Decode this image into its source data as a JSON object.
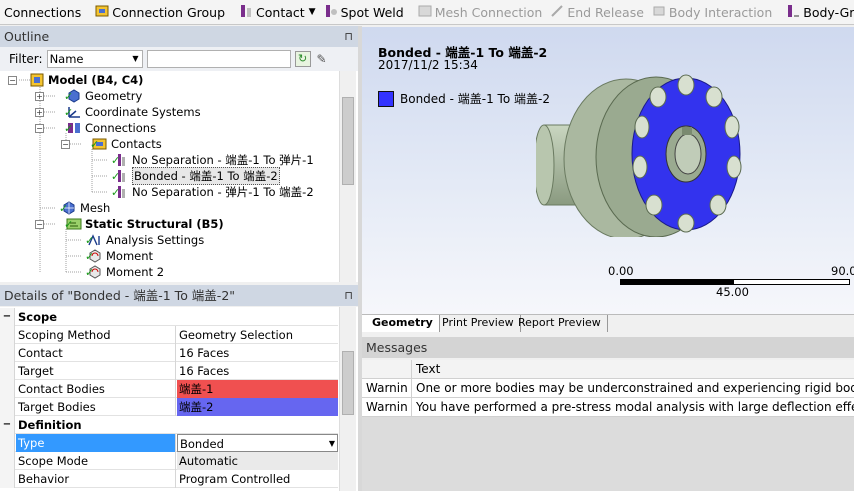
{
  "toolbar": {
    "connections": "Connections",
    "connection_group": "Connection Group",
    "contact": "Contact",
    "spot_weld": "Spot Weld",
    "mesh_connection": "Mesh Connection",
    "end_release": "End Release",
    "body_interaction": "Body Interaction",
    "body_ground": "Body-Grou"
  },
  "outline": {
    "title": "Outline",
    "filter_label": "Filter:",
    "filter_value": "Name",
    "tree": [
      {
        "label": "Model (B4, C4)",
        "bold": true
      },
      {
        "label": "Geometry"
      },
      {
        "label": "Coordinate Systems"
      },
      {
        "label": "Connections"
      },
      {
        "label": "Contacts"
      },
      {
        "label": "No Separation - 端盖-1 To 弹片-1"
      },
      {
        "label": "Bonded - 端盖-1 To 端盖-2"
      },
      {
        "label": "No Separation - 弹片-1 To 端盖-2"
      },
      {
        "label": "Mesh"
      },
      {
        "label": "Static Structural (B5)",
        "bold": true
      },
      {
        "label": "Analysis Settings"
      },
      {
        "label": "Moment"
      },
      {
        "label": "Moment 2"
      }
    ]
  },
  "details": {
    "title": "Details of \"Bonded - 端盖-1 To 端盖-2\"",
    "rows": [
      {
        "key": "Scope",
        "section": true
      },
      {
        "key": "Scoping Method",
        "value": "Geometry Selection"
      },
      {
        "key": "Contact",
        "value": "16 Faces"
      },
      {
        "key": "Target",
        "value": "16 Faces"
      },
      {
        "key": "Contact Bodies",
        "value": "端盖-1"
      },
      {
        "key": "Target Bodies",
        "value": "端盖-2"
      },
      {
        "key": "Definition",
        "section": true
      },
      {
        "key": "Type",
        "value": "Bonded"
      },
      {
        "key": "Scope Mode",
        "value": "Automatic"
      },
      {
        "key": "Behavior",
        "value": "Program Controlled"
      }
    ],
    "colors": {
      "contact": "#f05050",
      "target": "#6666f0",
      "selected": "#3399ff"
    }
  },
  "viewport": {
    "title": "Bonded - 端盖-1 To 端盖-2",
    "date": "2017/11/2 15:34",
    "legend": "Bonded - 端盖-1 To 端盖-2",
    "legend_color": "#3333ff",
    "scale_left": "0.00",
    "scale_right": "90.0",
    "scale_mid": "45.00"
  },
  "tabs": [
    "Geometry",
    "Print Preview",
    "Report Preview"
  ],
  "messages": {
    "title": "Messages",
    "header": "Text",
    "rows": [
      {
        "type": "Warnin",
        "text": "One or more bodies may be underconstrained and experiencing rigid body"
      },
      {
        "type": "Warnin",
        "text": "You have performed a pre-stress modal analysis with large deflection effec"
      }
    ]
  }
}
